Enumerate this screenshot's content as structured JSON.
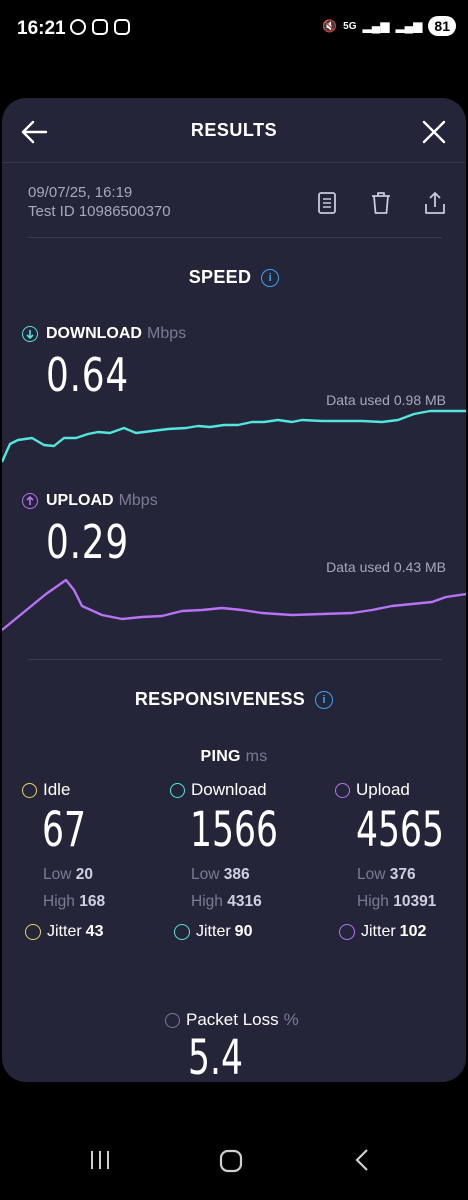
{
  "status_bar": {
    "time": "16:21",
    "battery": "81",
    "network": "5G"
  },
  "header": {
    "title": "RESULTS"
  },
  "meta": {
    "date": "09/07/25, 16:19",
    "test_id": "Test ID 10986500370"
  },
  "speed": {
    "title": "SPEED",
    "download": {
      "label": "DOWNLOAD",
      "unit": "Mbps",
      "value": "0.64",
      "data_used": "Data used 0.98 MB",
      "color": "#52e6dc"
    },
    "upload": {
      "label": "UPLOAD",
      "unit": "Mbps",
      "value": "0.29",
      "data_used": "Data used 0.43 MB",
      "color": "#b873f5"
    }
  },
  "responsiveness": {
    "title": "RESPONSIVENESS",
    "ping_label": "PING",
    "ping_unit": "ms",
    "columns": [
      {
        "label": "Idle",
        "value": "67",
        "low_label": "Low",
        "low": "20",
        "high_label": "High",
        "high": "168",
        "jitter_label": "Jitter",
        "jitter": "43",
        "color": "#f0d066"
      },
      {
        "label": "Download",
        "value": "1566",
        "low_label": "Low",
        "low": "386",
        "high_label": "High",
        "high": "4316",
        "jitter_label": "Jitter",
        "jitter": "90",
        "color": "#52e6dc"
      },
      {
        "label": "Upload",
        "value": "4565",
        "low_label": "Low",
        "low": "376",
        "high_label": "High",
        "high": "10391",
        "jitter_label": "Jitter",
        "jitter": "102",
        "color": "#b873f5"
      }
    ]
  },
  "packet_loss": {
    "label": "Packet Loss",
    "unit": "%",
    "value": "5.4"
  }
}
